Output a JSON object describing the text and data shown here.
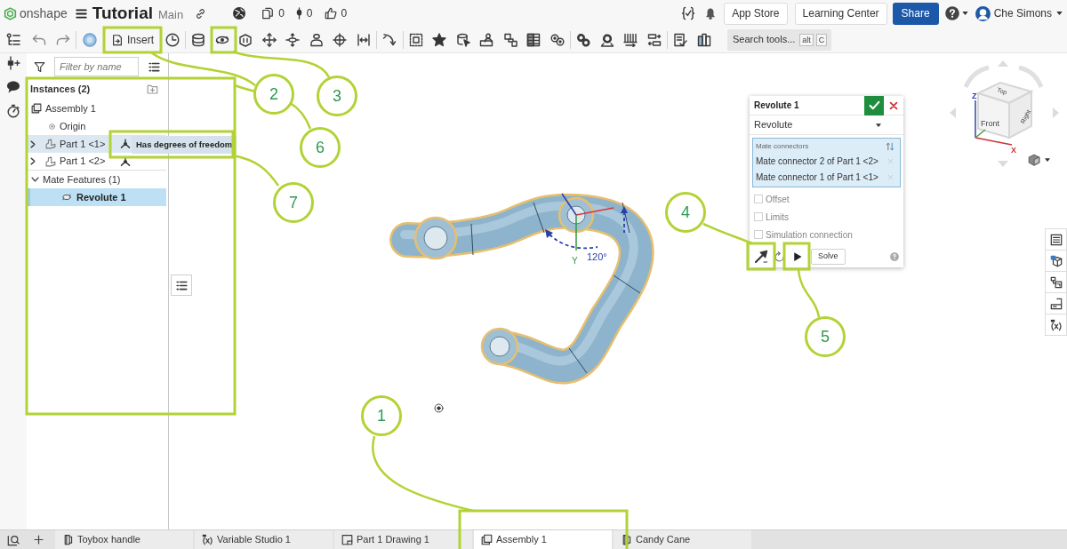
{
  "header": {
    "logo_text": "onshape",
    "title": "Tutorial",
    "workspace": "Main",
    "stats": [
      {
        "kind": "copies",
        "value": "0"
      },
      {
        "kind": "pins",
        "value": "0"
      },
      {
        "kind": "likes",
        "value": "0"
      }
    ],
    "buttons": [
      {
        "label": "App Store",
        "kind": "plain"
      },
      {
        "label": "Learning Center",
        "kind": "plain"
      },
      {
        "label": "Share",
        "kind": "primary"
      }
    ],
    "user": {
      "name": "Che Simons"
    }
  },
  "toolbar": {
    "insert_label": "Insert",
    "search": {
      "label": "Search tools...",
      "keys": [
        "alt",
        "C"
      ]
    }
  },
  "feature_panel": {
    "filter": {
      "placeholder": "Filter by name"
    },
    "instances": {
      "title": "Instances (2)",
      "items": [
        {
          "label": "Assembly 1",
          "kind": "assembly",
          "hovered": false,
          "children": [
            {
              "label": "Origin",
              "kind": "origin",
              "hovered": false
            }
          ]
        },
        {
          "label": "Part 1 <1>",
          "kind": "part",
          "hovered": true,
          "expanded": false,
          "dof": true,
          "tooltip": "Has degrees of freedom"
        },
        {
          "label": "Part 1 <2>",
          "kind": "part",
          "hovered": false,
          "expanded": false,
          "dof": true
        }
      ]
    },
    "mate_features": {
      "title": "Mate Features (1)",
      "expanded": true,
      "items": [
        {
          "label": "Revolute 1",
          "kind": "revolute",
          "selected": true
        }
      ]
    }
  },
  "viewport": {
    "axis_label": "Y",
    "angle_label": "120°"
  },
  "dialog": {
    "title": "Revolute 1",
    "type": "Revolute",
    "connectors": {
      "label": "Mate connectors",
      "items": [
        "Mate connector 2 of Part 1 <2>",
        "Mate connector 1 of Part 1 <1>"
      ]
    },
    "options": [
      {
        "label": "Offset",
        "checked": false
      },
      {
        "label": "Limits",
        "checked": false
      },
      {
        "label": "Simulation connection",
        "checked": false
      }
    ],
    "solve_label": "Solve"
  },
  "view_cube": {
    "faces": [
      "Top",
      "Front",
      "Right"
    ],
    "axes": [
      "Z",
      "X"
    ]
  },
  "tabs": [
    {
      "label": "Toybox handle",
      "kind": "part_studio",
      "selected": false
    },
    {
      "label": "Variable Studio 1",
      "kind": "variable_studio",
      "selected": false
    },
    {
      "label": "Part 1 Drawing 1",
      "kind": "drawing",
      "selected": false
    },
    {
      "label": "Assembly 1",
      "kind": "assembly",
      "selected": true
    },
    {
      "label": "Candy Cane",
      "kind": "part_studio",
      "selected": false
    }
  ],
  "callouts": [
    {
      "number": "1"
    },
    {
      "number": "2"
    },
    {
      "number": "3"
    },
    {
      "number": "4"
    },
    {
      "number": "5"
    },
    {
      "number": "6"
    },
    {
      "number": "7"
    }
  ]
}
